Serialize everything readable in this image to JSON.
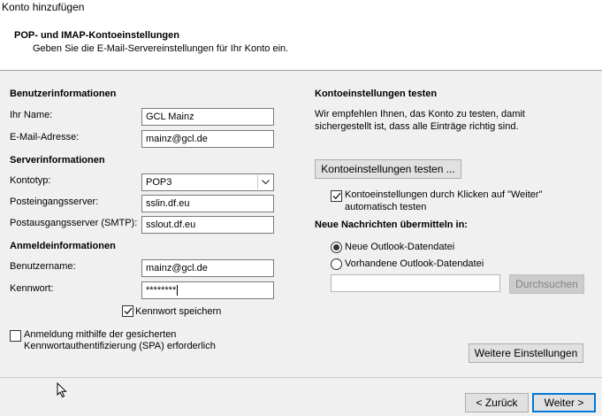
{
  "window": {
    "title": "Konto hinzufügen"
  },
  "header": {
    "title": "POP- und IMAP-Kontoeinstellungen",
    "subtitle": "Geben Sie die E-Mail-Servereinstellungen für Ihr Konto ein."
  },
  "user_info": {
    "section": "Benutzerinformationen",
    "name_label": "Ihr Name:",
    "name_value": "GCL Mainz",
    "email_label": "E-Mail-Adresse:",
    "email_value": "mainz@gcl.de"
  },
  "server_info": {
    "section": "Serverinformationen",
    "account_type_label": "Kontotyp:",
    "account_type_value": "POP3",
    "incoming_label": "Posteingangsserver:",
    "incoming_value": "sslin.df.eu",
    "outgoing_label": "Postausgangsserver (SMTP):",
    "outgoing_value": "sslout.df.eu"
  },
  "login_info": {
    "section": "Anmeldeinformationen",
    "username_label": "Benutzername:",
    "username_value": "mainz@gcl.de",
    "password_label": "Kennwort:",
    "password_value": "********",
    "save_password_label": "Kennwort speichern",
    "spa_label_line1": "Anmeldung mithilfe der gesicherten",
    "spa_label_line2": "Kennwortauthentifizierung (SPA) erforderlich"
  },
  "test_settings": {
    "section": "Kontoeinstellungen testen",
    "desc_line1": "Wir empfehlen Ihnen, das Konto zu testen, damit",
    "desc_line2": "sichergestellt ist, dass alle Einträge richtig sind.",
    "test_button": "Kontoeinstellungen testen ...",
    "auto_test_line1": "Kontoeinstellungen durch Klicken auf \"Weiter\"",
    "auto_test_line2": "automatisch testen"
  },
  "deliver": {
    "section": "Neue Nachrichten übermitteln in:",
    "new_file_label": "Neue Outlook-Datendatei",
    "existing_file_label": "Vorhandene Outlook-Datendatei",
    "path_value": "",
    "browse_button": "Durchsuchen"
  },
  "buttons": {
    "more_settings": "Weitere Einstellungen",
    "back": "< Zurück",
    "next": "Weiter >"
  }
}
